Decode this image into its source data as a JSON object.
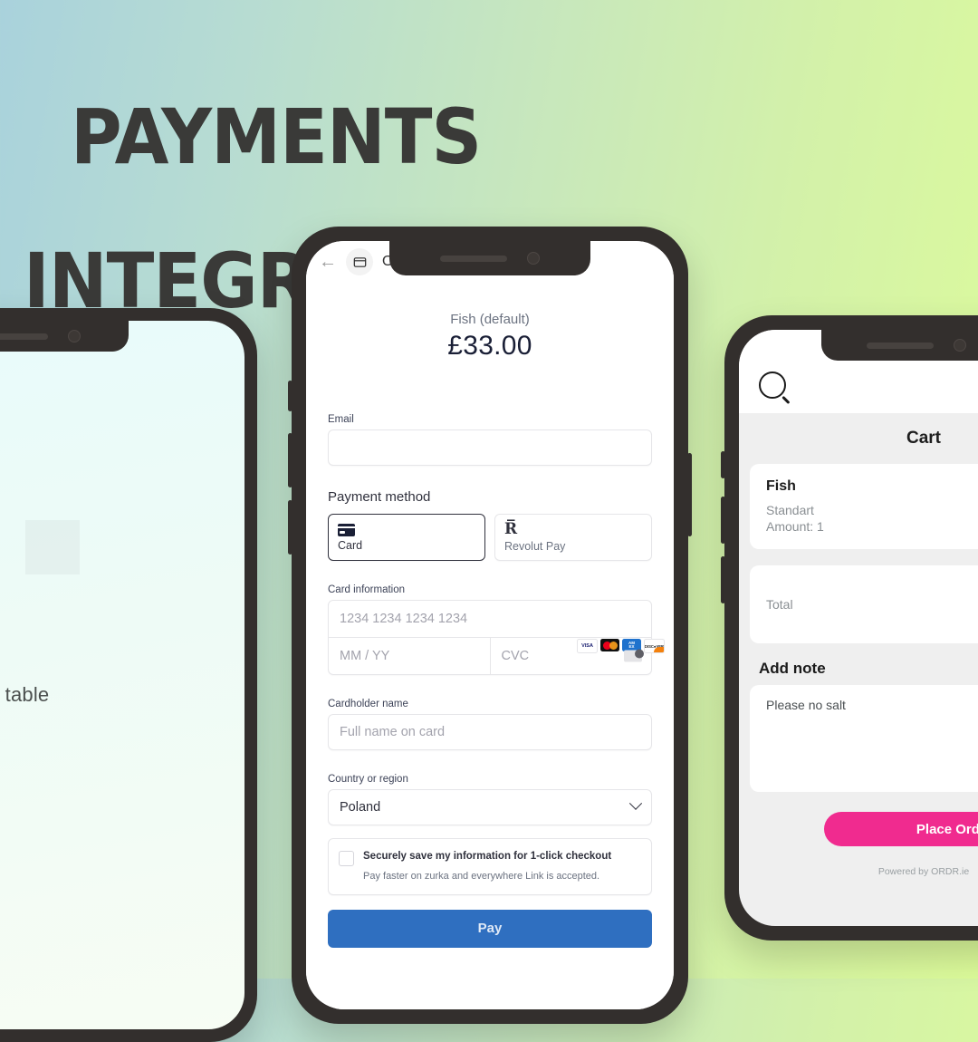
{
  "poster": {
    "headline_line1": "PAYMENTS",
    "headline_line2": "INTEGRATION",
    "background_from": "#a9d2dc",
    "background_to": "#ddfc9a",
    "headline_color": "#3a3a38"
  },
  "phone_left": {
    "screen_caption": "Scan QR on the table"
  },
  "phone_center": {
    "browser": {
      "back_label": "←",
      "site_icon": "storefront-icon",
      "title": "O"
    },
    "checkout": {
      "merchant": "Fish (default)",
      "amount": "£33.00",
      "email_label": "Email",
      "email_value": "",
      "payment_method_label": "Payment method",
      "methods": [
        {
          "label": "Card",
          "icon": "credit-card-icon",
          "selected": true
        },
        {
          "label": "Revolut Pay",
          "icon": "revolut-r-icon",
          "selected": false
        }
      ],
      "card_information_label": "Card information",
      "card_number_placeholder": "1234 1234 1234 1234",
      "card_brands": [
        "VISA",
        "Mastercard",
        "Amex",
        "Discover"
      ],
      "expiry_placeholder": "MM / YY",
      "cvc_placeholder": "CVC",
      "cardholder_label": "Cardholder name",
      "cardholder_placeholder": "Full name on card",
      "country_label": "Country or region",
      "country_value": "Poland",
      "save_checkbox_checked": false,
      "save_title": "Securely save my information for 1-click checkout",
      "save_subtitle": "Pay faster on zurka and everywhere Link is accepted.",
      "pay_button": "Pay",
      "pay_button_color": "#2f6fc0"
    }
  },
  "phone_right": {
    "search_icon": "search-icon",
    "cart_title": "Cart",
    "items": [
      {
        "name": "Fish",
        "variant": "Standart",
        "amount": "Amount: 1"
      }
    ],
    "total_label": "Total",
    "add_note_label": "Add note",
    "note_value": "Please no salt",
    "place_order_button": "Place Order",
    "place_order_color": "#f02b8f",
    "footer": "Powered by ORDR.ie"
  }
}
